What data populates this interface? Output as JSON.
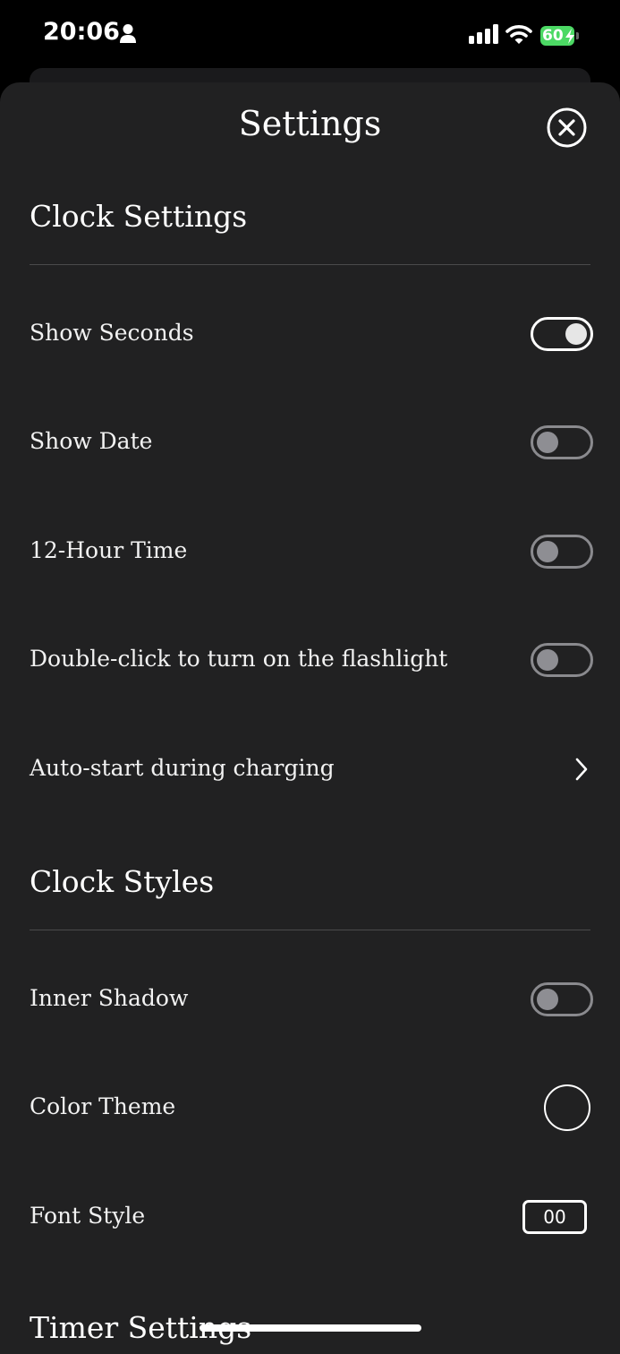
{
  "status_bar": {
    "time": "20:06",
    "battery": "60",
    "icons": [
      "person-icon",
      "signal-icon",
      "wifi-icon",
      "battery-charging-icon"
    ],
    "battery_color": "#4cd964"
  },
  "sheet": {
    "title": "Settings",
    "close_icon": "close-circle-icon"
  },
  "sections": {
    "clock_settings": {
      "title": "Clock Settings",
      "rows": {
        "show_seconds": {
          "label": "Show Seconds",
          "on": true
        },
        "show_date": {
          "label": "Show Date",
          "on": false
        },
        "twelve_hour": {
          "label": "12-Hour Time",
          "on": false
        },
        "flashlight": {
          "label": "Double-click to turn on the flashlight",
          "on": false
        },
        "auto_start": {
          "label": "Auto-start during charging",
          "icon": "chevron-right-icon"
        }
      }
    },
    "clock_styles": {
      "title": "Clock Styles",
      "rows": {
        "inner_shadow": {
          "label": "Inner Shadow",
          "on": false
        },
        "color_theme": {
          "label": "Color Theme"
        },
        "font_style": {
          "label": "Font Style",
          "value": "00"
        }
      }
    },
    "timer_settings": {
      "title": "Timer Settings"
    }
  },
  "colors": {
    "sheet_background": "#212122",
    "toggle_off": "#8e8e93",
    "toggle_on": "#ffffff"
  }
}
